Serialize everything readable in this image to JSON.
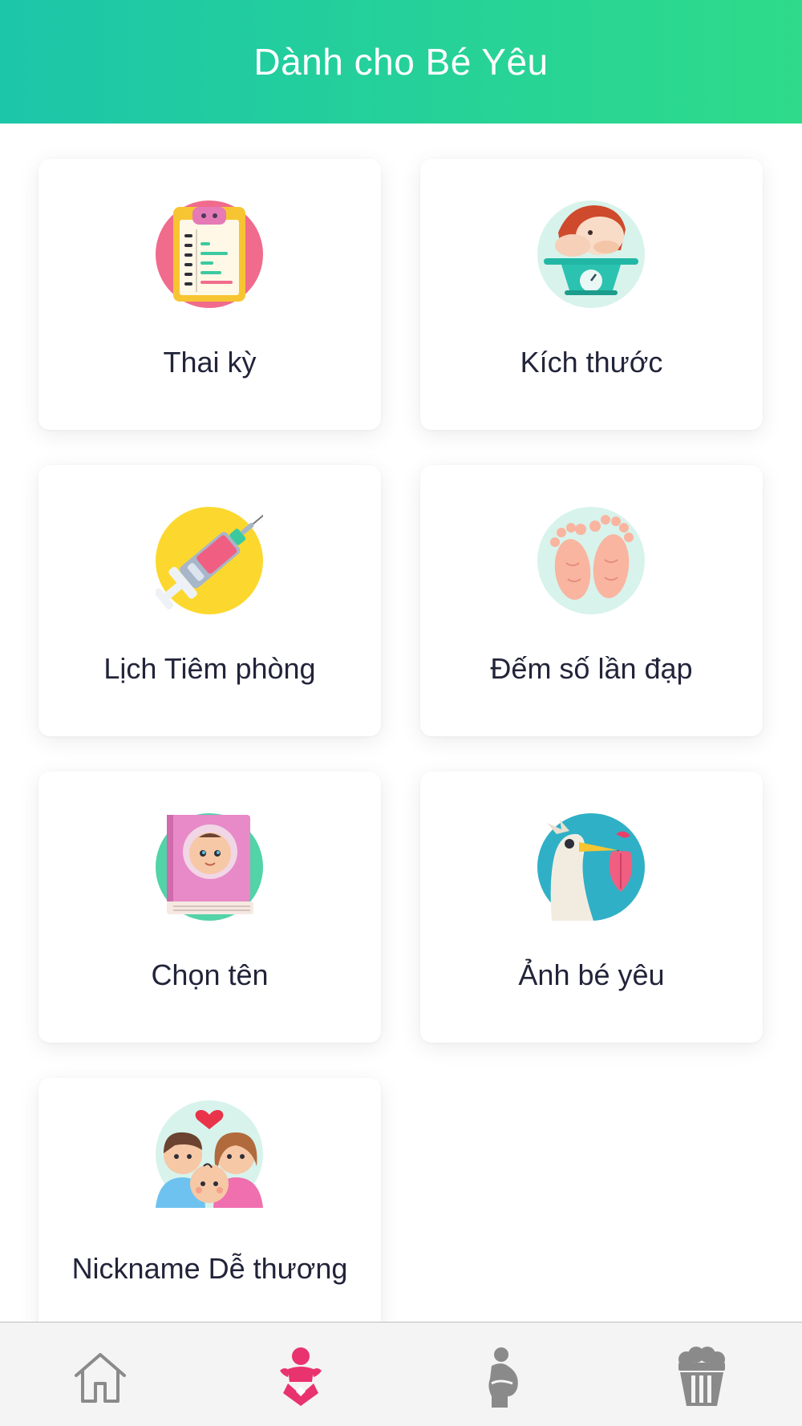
{
  "header": {
    "title": "Dành cho Bé Yêu"
  },
  "cards": [
    {
      "label": "Thai kỳ",
      "icon": "pregnancy-checklist-icon"
    },
    {
      "label": "Kích thước",
      "icon": "baby-scale-icon"
    },
    {
      "label": "Lịch Tiêm phòng",
      "icon": "vaccine-syringe-icon"
    },
    {
      "label": "Đếm số lần đạp",
      "icon": "baby-feet-icon"
    },
    {
      "label": "Chọn tên",
      "icon": "baby-name-book-icon"
    },
    {
      "label": "Ảnh bé yêu",
      "icon": "stork-icon"
    },
    {
      "label": "Nickname Dễ thương",
      "icon": "family-heart-icon"
    }
  ],
  "tabbar": {
    "active_index": 1,
    "active_color": "#e8336f",
    "inactive_color": "#8a8a8a",
    "tabs": [
      {
        "icon": "home-icon"
      },
      {
        "icon": "baby-icon"
      },
      {
        "icon": "pregnant-mother-icon"
      },
      {
        "icon": "popcorn-icon"
      }
    ]
  },
  "colors": {
    "header_gradient_start": "#1cc6a9",
    "header_gradient_end": "#2edb8a",
    "text": "#22243a"
  }
}
